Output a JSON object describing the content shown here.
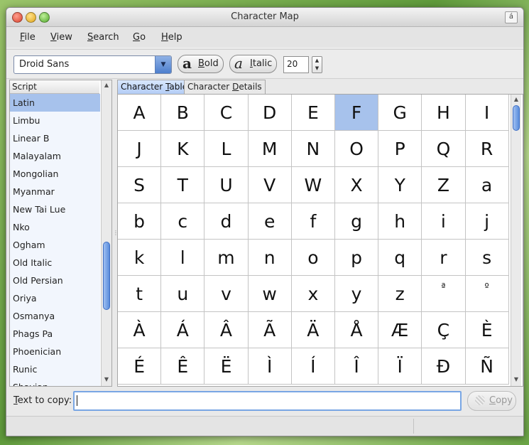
{
  "window": {
    "title": "Character Map",
    "title_button": "á"
  },
  "menubar": [
    {
      "pre": "",
      "u": "F",
      "post": "ile"
    },
    {
      "pre": "",
      "u": "V",
      "post": "iew"
    },
    {
      "pre": "",
      "u": "S",
      "post": "earch"
    },
    {
      "pre": "",
      "u": "G",
      "post": "o"
    },
    {
      "pre": "",
      "u": "H",
      "post": "elp"
    }
  ],
  "toolbar": {
    "font_family": "Droid Sans",
    "bold_glyph": "a",
    "bold_label_u": "B",
    "bold_label_rest": "old",
    "italic_glyph": "a",
    "italic_label_u": "I",
    "italic_label_rest": "talic",
    "font_size": "20"
  },
  "script_list": {
    "header": "Script",
    "selected": "Latin",
    "items": [
      "Latin",
      "Limbu",
      "Linear B",
      "Malayalam",
      "Mongolian",
      "Myanmar",
      "New Tai Lue",
      "Nko",
      "Ogham",
      "Old Italic",
      "Old Persian",
      "Oriya",
      "Osmanya",
      "Phags Pa",
      "Phoenician",
      "Runic",
      "Shavian"
    ]
  },
  "tabs": [
    {
      "pre": "Character ",
      "u": "T",
      "post": "able",
      "active": true
    },
    {
      "pre": "Character ",
      "u": "D",
      "post": "etails",
      "active": false
    }
  ],
  "character_table": {
    "selected": "F",
    "cells": [
      "A",
      "B",
      "C",
      "D",
      "E",
      "F",
      "G",
      "H",
      "I",
      "J",
      "K",
      "L",
      "M",
      "N",
      "O",
      "P",
      "Q",
      "R",
      "S",
      "T",
      "U",
      "V",
      "W",
      "X",
      "Y",
      "Z",
      "a",
      "b",
      "c",
      "d",
      "e",
      "f",
      "g",
      "h",
      "i",
      "j",
      "k",
      "l",
      "m",
      "n",
      "o",
      "p",
      "q",
      "r",
      "s",
      "t",
      "u",
      "v",
      "w",
      "x",
      "y",
      "z",
      "ª",
      "º",
      "À",
      "Á",
      "Â",
      "Ã",
      "Ä",
      "Å",
      "Æ",
      "Ç",
      "È",
      "É",
      "Ê",
      "Ë",
      "Ì",
      "Í",
      "Î",
      "Ï",
      "Đ",
      "Ñ"
    ],
    "small_cells": [
      "ª",
      "º"
    ]
  },
  "copy_row": {
    "label_pre": "",
    "label_u": "T",
    "label_post": "ext to copy:",
    "value": "",
    "button_u": "C",
    "button_rest": "opy"
  }
}
